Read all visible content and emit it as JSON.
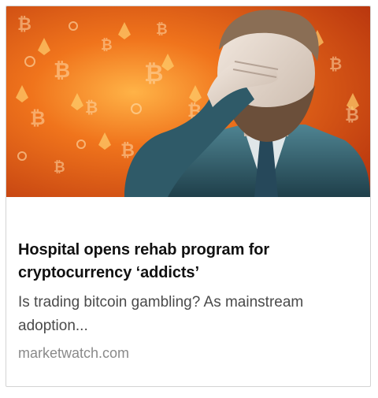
{
  "article": {
    "headline": "Hospital opens rehab program for cryptocurrency ‘addicts’",
    "snippet": "Is trading bitcoin gambling? As mainstream adoption...",
    "source": "marketwatch.com"
  },
  "thumbnail": {
    "icon_names": [
      "bitcoin-icon",
      "ethereum-icon",
      "ripple-icon"
    ],
    "colors": {
      "orange": "#f0741c",
      "dark_orange": "#b8350e",
      "teal": "#3d6f7c"
    }
  }
}
